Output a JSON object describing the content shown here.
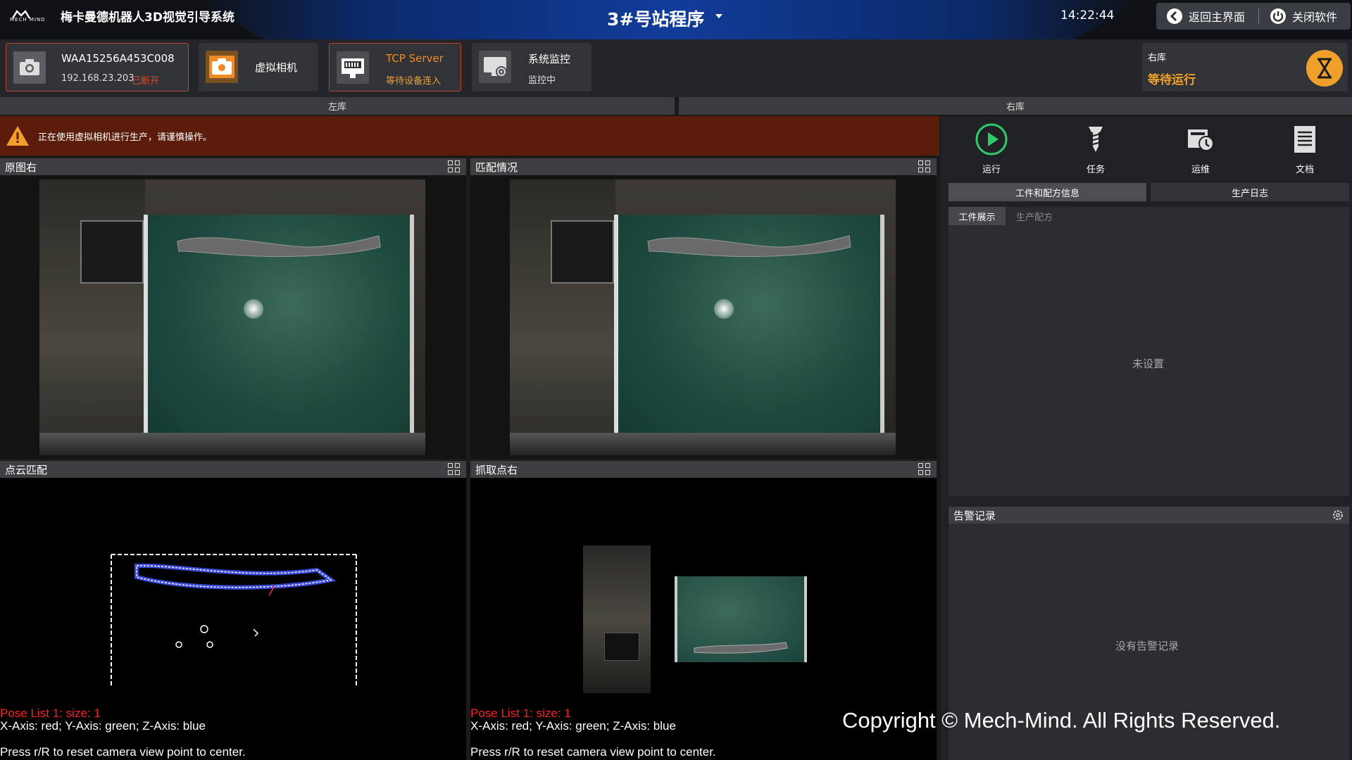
{
  "header": {
    "logo_text": "MECH MIND",
    "app_title": "梅卡曼德机器人3D视觉引导系统",
    "project_name": "3#号站程序",
    "time": "14:22:44",
    "back_label": "返回主界面",
    "close_label": "关闭软件",
    "accent": "#1a4bb5"
  },
  "devices": [
    {
      "line1": "WAA15256A453C008",
      "line2": "192.168.23.203",
      "line2_status": "已断开",
      "status_color": "#e0452b",
      "icon": "camera-icon"
    },
    {
      "line1": "虚拟相机",
      "icon": "virtual-camera-icon"
    },
    {
      "line1": "TCP Server",
      "line2": "等待设备连入",
      "status_color": "#e8a23a",
      "icon": "network-icon"
    },
    {
      "line1": "系统监控",
      "line2": "监控中",
      "icon": "monitor-icon"
    }
  ],
  "status_card": {
    "title": "右库",
    "status": "等待运行",
    "status_color": "#f0a02a",
    "icon": "hourglass-icon"
  },
  "libs": {
    "left": "左库",
    "right": "右库"
  },
  "warning": {
    "text": "正在使用虚拟相机进行生产，请谨慎操作。",
    "icon": "warning-icon"
  },
  "panels": {
    "p1": {
      "title": "原图右"
    },
    "p2": {
      "title": "匹配情况"
    },
    "p3": {
      "title": "点云匹配",
      "pose": "Pose List 1: size: 1",
      "axes": "X-Axis: red; Y-Axis: green; Z-Axis: blue",
      "hint": "Press r/R to reset camera view point to center."
    },
    "p4": {
      "title": "抓取点右",
      "pose": "Pose List 1: size: 1",
      "axes": "X-Axis: red; Y-Axis: green; Z-Axis: blue",
      "hint": "Press r/R to reset camera view point to center."
    }
  },
  "sidebar": {
    "buttons": [
      {
        "label": "运行",
        "icon": "play-icon"
      },
      {
        "label": "任务",
        "icon": "task-icon"
      },
      {
        "label": "运维",
        "icon": "maintenance-icon"
      },
      {
        "label": "文档",
        "icon": "document-icon"
      }
    ],
    "tabs": [
      "工件和配方信息",
      "生产日志"
    ],
    "subtabs": [
      "工件展示",
      "生产配方"
    ],
    "empty_text": "未设置",
    "alarm_title": "告警记录",
    "alarm_empty": "没有告警记录"
  },
  "copyright": "Copyright © Mech-Mind. All Rights Reserved."
}
